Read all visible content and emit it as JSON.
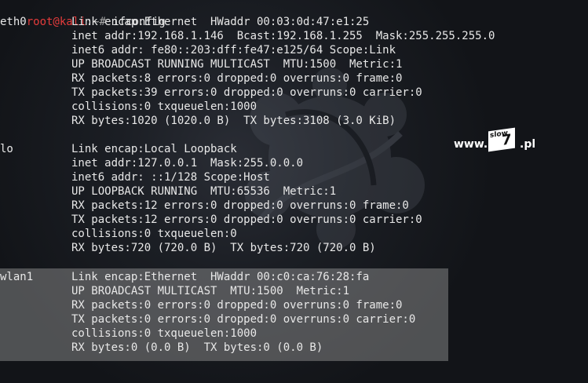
{
  "terminal": {
    "prompt_user": "root@kali",
    "prompt_path": ":~# ",
    "command": "ifconfig",
    "interfaces": [
      {
        "name": "eth0",
        "lines": [
          "Link encap:Ethernet  HWaddr 00:03:0d:47:e1:25",
          "inet addr:192.168.1.146  Bcast:192.168.1.255  Mask:255.255.255.0",
          "inet6 addr: fe80::203:dff:fe47:e125/64 Scope:Link",
          "UP BROADCAST RUNNING MULTICAST  MTU:1500  Metric:1",
          "RX packets:8 errors:0 dropped:0 overruns:0 frame:0",
          "TX packets:39 errors:0 dropped:0 overruns:0 carrier:0",
          "collisions:0 txqueuelen:1000",
          "RX bytes:1020 (1020.0 B)  TX bytes:3108 (3.0 KiB)"
        ]
      },
      {
        "name": "lo",
        "lines": [
          "Link encap:Local Loopback",
          "inet addr:127.0.0.1  Mask:255.0.0.0",
          "inet6 addr: ::1/128 Scope:Host",
          "UP LOOPBACK RUNNING  MTU:65536  Metric:1",
          "RX packets:12 errors:0 dropped:0 overruns:0 frame:0",
          "TX packets:12 errors:0 dropped:0 overruns:0 carrier:0",
          "collisions:0 txqueuelen:0",
          "RX bytes:720 (720.0 B)  TX bytes:720 (720.0 B)"
        ]
      },
      {
        "name": "wlan1",
        "lines": [
          "Link encap:Ethernet  HWaddr 00:c0:ca:76:28:fa",
          "UP BROADCAST MULTICAST  MTU:1500  Metric:1",
          "RX packets:0 errors:0 dropped:0 overruns:0 frame:0",
          "TX packets:0 errors:0 dropped:0 overruns:0 carrier:0",
          "collisions:0 txqueuelen:1000",
          "RX bytes:0 (0.0 B)  TX bytes:0 (0.0 B)"
        ]
      }
    ]
  },
  "watermark": {
    "www": "www.",
    "slow": "slow",
    "seven": "7",
    "pl": ".pl"
  },
  "colors": {
    "background": "#121418",
    "text": "#e8e8e8",
    "prompt_user": "#e43b3b",
    "selection": "#9b9b9b"
  }
}
